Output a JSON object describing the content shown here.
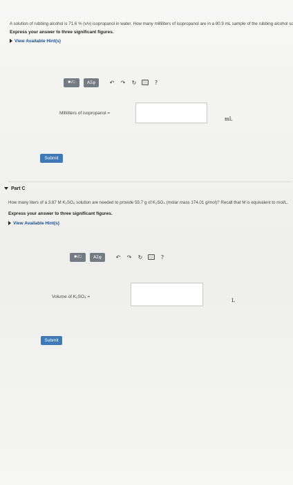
{
  "part_b": {
    "question": "A solution of rubbing alcohol is 71.6 % (v/v) isopropanol in water. How many milliliters of isopropanol are in a 80.9 mL sample of the rubbing alcohol solution?",
    "instruction": "Express your answer to three significant figures.",
    "hints_link": "View Available Hint(s)",
    "toolbar": {
      "sqrt_label": "■√□",
      "greek_label": "ΑΣφ",
      "help_label": "?"
    },
    "input_label": "Milliliters of isopropanol =",
    "input_value": "",
    "unit": "mL",
    "submit_label": "Submit"
  },
  "part_c": {
    "title": "Part C",
    "question": "How many liters of a 3.87 M K₂SO₄ solution are needed to provide 55.7 g of K₂SO₄ (molar mass 174.01 g/mol)? Recall that M is equivalent to mol/L.",
    "instruction": "Express your answer to three significant figures.",
    "hints_link": "View Available Hint(s)",
    "toolbar": {
      "sqrt_label": "■√□",
      "greek_label": "ΑΣφ",
      "help_label": "?"
    },
    "input_label": "Volume of K₂SO₄ =",
    "input_value": "",
    "unit": "L",
    "submit_label": "Submit"
  }
}
